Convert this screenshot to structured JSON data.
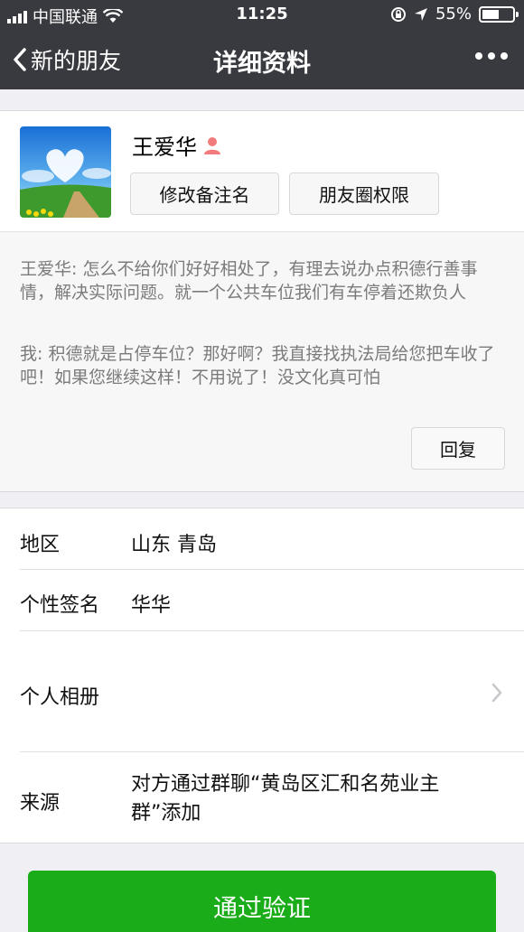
{
  "status_bar": {
    "carrier": "中国联通",
    "time": "11:25",
    "battery": "55%",
    "battery_level": 0.55
  },
  "nav": {
    "back_label": "新的朋友",
    "title": "详细资料"
  },
  "profile": {
    "name": "王爱华",
    "buttons": {
      "edit_remark": "修改备注名",
      "moments_permission": "朋友圈权限"
    }
  },
  "moments": {
    "messages": [
      "王爱华: 怎么不给你们好好相处了，有理去说办点积德行善事情，解决实际问题。就一个公共车位我们有车停着还欺负人",
      "我: 积德就是占停车位？那好啊？我直接找执法局给您把车收了吧！如果您继续这样！不用说了！没文化真可怕"
    ],
    "reply_label": "回复"
  },
  "info": {
    "region_label": "地区",
    "region_value": "山东 青岛",
    "signature_label": "个性签名",
    "signature_value": "华华",
    "album_label": "个人相册",
    "source_label": "来源",
    "source_value": "对方通过群聊“黄岛区汇和名苑业主群”添加"
  },
  "verify_button": "通过验证",
  "colors": {
    "nav_bg": "#393a3f",
    "accent_green": "#1aad19",
    "female_icon": "#f37b7d"
  }
}
